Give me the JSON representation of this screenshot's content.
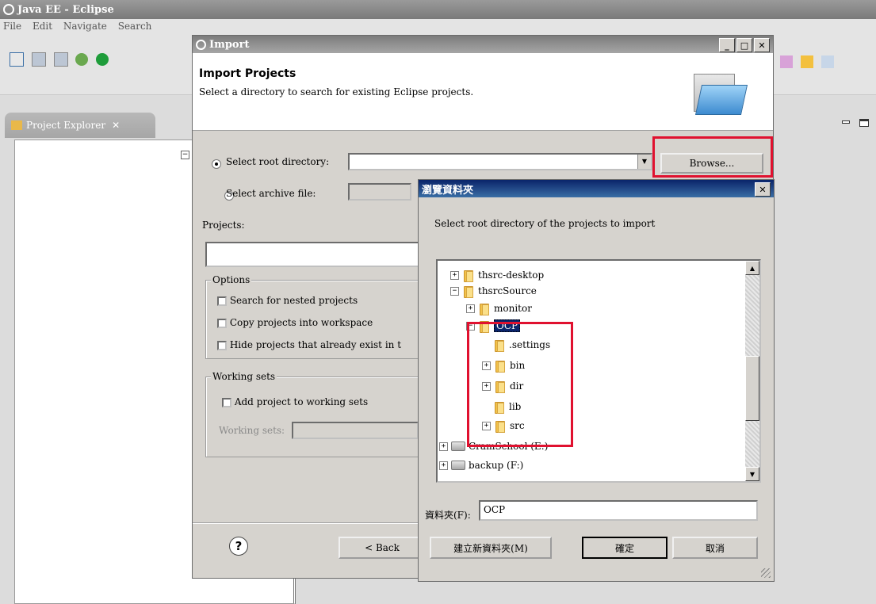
{
  "eclipse": {
    "title": "Java EE - Eclipse",
    "menu": [
      "File",
      "Edit",
      "Navigate",
      "Search"
    ],
    "project_explorer_tab": "Project Explorer"
  },
  "import_dialog": {
    "title": "Import",
    "header_title": "Import Projects",
    "header_desc": "Select a directory to search for existing Eclipse projects.",
    "select_root_label": "Select root directory:",
    "select_archive_label": "Select archive file:",
    "browse_button": "Browse...",
    "projects_label": "Projects:",
    "options_legend": "Options",
    "options": [
      "Search for nested projects",
      "Copy projects into workspace",
      "Hide projects that already exist in t"
    ],
    "working_sets_legend": "Working sets",
    "add_to_working_sets": "Add project to working sets",
    "working_sets_label": "Working sets:",
    "back_button": "< Back",
    "help_icon": "help-icon"
  },
  "browse_dialog": {
    "title": "瀏覽資料夾",
    "instruction": "Select root directory of the projects to import",
    "tree": [
      {
        "label": "thsrc-desktop",
        "indent": 1,
        "expander": "+",
        "icon": "folder"
      },
      {
        "label": "thsrcSource",
        "indent": 1,
        "expander": "-",
        "icon": "folder"
      },
      {
        "label": "monitor",
        "indent": 2,
        "expander": "+",
        "icon": "folder"
      },
      {
        "label": "OCP",
        "indent": 2,
        "expander": "-",
        "icon": "folder",
        "selected": true
      },
      {
        "label": ".settings",
        "indent": 3,
        "expander": "",
        "icon": "folder"
      },
      {
        "label": "bin",
        "indent": 3,
        "expander": "+",
        "icon": "folder"
      },
      {
        "label": "dir",
        "indent": 3,
        "expander": "+",
        "icon": "folder"
      },
      {
        "label": "lib",
        "indent": 3,
        "expander": "",
        "icon": "folder"
      },
      {
        "label": "src",
        "indent": 3,
        "expander": "+",
        "icon": "folder"
      },
      {
        "label": "CramSchool (E:)",
        "indent": 0,
        "expander": "+",
        "icon": "drive"
      },
      {
        "label": "backup (F:)",
        "indent": 0,
        "expander": "+",
        "icon": "drive"
      }
    ],
    "folder_label": "資料夾(F):",
    "folder_value": "OCP",
    "new_folder_button": "建立新資料夾(M)",
    "ok_button": "確定",
    "cancel_button": "取消"
  },
  "colors": {
    "highlight_red": "#e0112f",
    "selection_blue": "#0a246a"
  }
}
